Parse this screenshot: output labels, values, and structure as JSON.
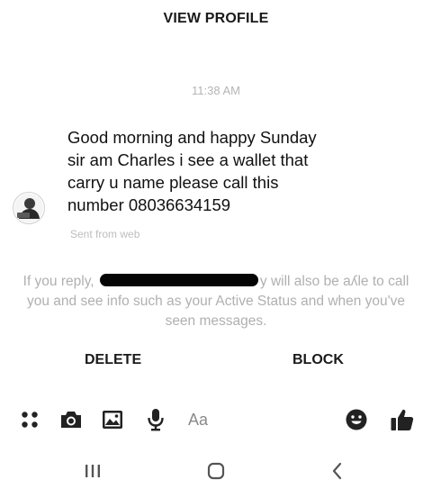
{
  "header": {
    "view_profile_label": "VIEW PROFILE"
  },
  "conversation": {
    "timestamp": "11:38 AM",
    "message_text": "Good morning and happy Sunday\nsir am Charles i see a wallet  that\ncarry u name please call this\nnumber 08036634159",
    "sent_from": "Sent from web"
  },
  "notice": {
    "before": "If you reply, ",
    "after": "y will also be aʎle to call you and see info such as your Active Status and when you've seen messages."
  },
  "actions": {
    "delete_label": "DELETE",
    "block_label": "BLOCK"
  },
  "composer": {
    "placeholder": "Aa",
    "icons": [
      "menu-dots-icon",
      "camera-icon",
      "gallery-icon",
      "microphone-icon",
      "emoji-icon",
      "thumbs-up-icon"
    ]
  },
  "navbar": {
    "icons": [
      "recent-apps-icon",
      "home-icon",
      "back-icon"
    ]
  },
  "colors": {
    "text": "#111111",
    "muted": "#b0b0b0",
    "icon": "#222222"
  }
}
